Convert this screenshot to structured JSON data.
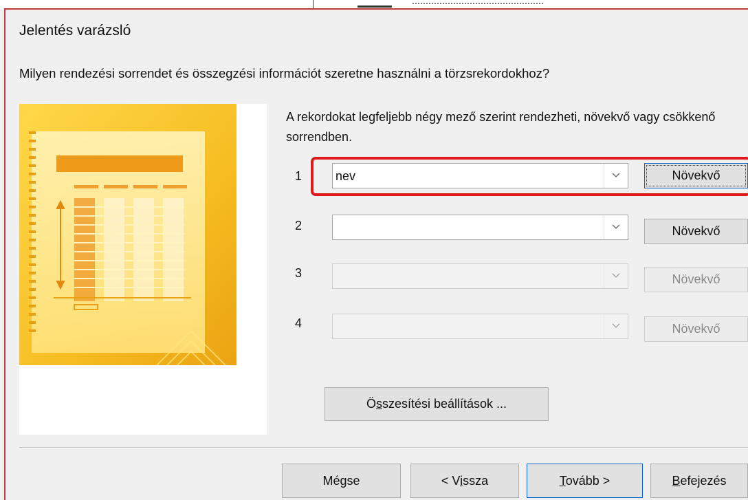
{
  "window": {
    "title": "Jelentés varázsló"
  },
  "question": "Milyen rendezési sorrendet és összegzési információt szeretne használni a törzsrekordokhoz?",
  "instruction": "A rekordokat legfeljebb négy mező szerint rendezheti, növekvő vagy csökkenő sorrendben.",
  "sort_rows": [
    {
      "number": "1",
      "field_value": "nev",
      "order_label": "Növekvő",
      "enabled": true,
      "focused": true
    },
    {
      "number": "2",
      "field_value": "",
      "order_label": "Növekvő",
      "enabled": true,
      "focused": false
    },
    {
      "number": "3",
      "field_value": "",
      "order_label": "Növekvő",
      "enabled": false,
      "focused": false
    },
    {
      "number": "4",
      "field_value": "",
      "order_label": "Növekvő",
      "enabled": false,
      "focused": false
    }
  ],
  "summary_button": {
    "prefix": "Ö",
    "mnemonic": "s",
    "suffix": "szesítési beállítások ..."
  },
  "footer": {
    "cancel": "Mégse",
    "back": {
      "prefix": "< V",
      "mnemonic": "i",
      "suffix": "ssza"
    },
    "next": {
      "prefix": "",
      "mnemonic": "T",
      "suffix": "ovább >"
    },
    "finish": {
      "prefix": "",
      "mnemonic": "B",
      "suffix": "efejezés"
    }
  },
  "icons": {
    "dropdown": "chevron-down-icon",
    "preview": "report-preview-illustration"
  },
  "colors": {
    "highlight": "#e01a1a",
    "dialog_border": "#c0393b",
    "focus_border": "#0a63c7",
    "preview_gold": "#f5c230"
  }
}
